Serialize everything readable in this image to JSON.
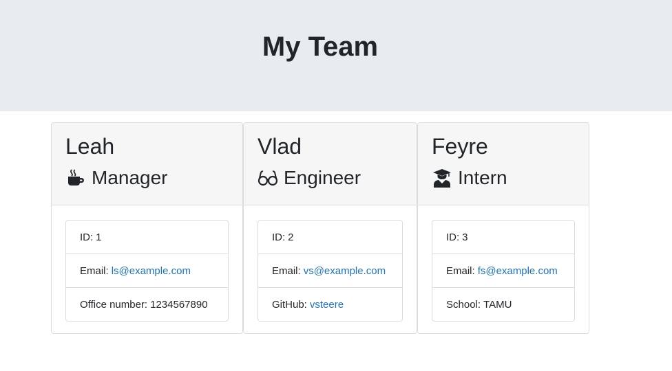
{
  "header": {
    "title": "My Team"
  },
  "colors": {
    "jumbotron_bg": "#e9ecef",
    "link": "#1a73c8",
    "card_header_bg": "#f6f6f6"
  },
  "team": [
    {
      "name": "Leah",
      "role": "Manager",
      "icon": "coffee-mug-icon",
      "id_label": "ID:",
      "id": "1",
      "email_label": "Email:",
      "email": "ls@example.com",
      "extra_label": "Office number:",
      "extra": "1234567890"
    },
    {
      "name": "Vlad",
      "role": "Engineer",
      "icon": "glasses-icon",
      "id_label": "ID:",
      "id": "2",
      "email_label": "Email:",
      "email": "vs@example.com",
      "extra_label": "GitHub:",
      "extra": "vsteere"
    },
    {
      "name": "Feyre",
      "role": "Intern",
      "icon": "graduate-icon",
      "id_label": "ID:",
      "id": "3",
      "email_label": "Email:",
      "email": "fs@example.com",
      "extra_label": "School:",
      "extra": "TAMU"
    }
  ]
}
